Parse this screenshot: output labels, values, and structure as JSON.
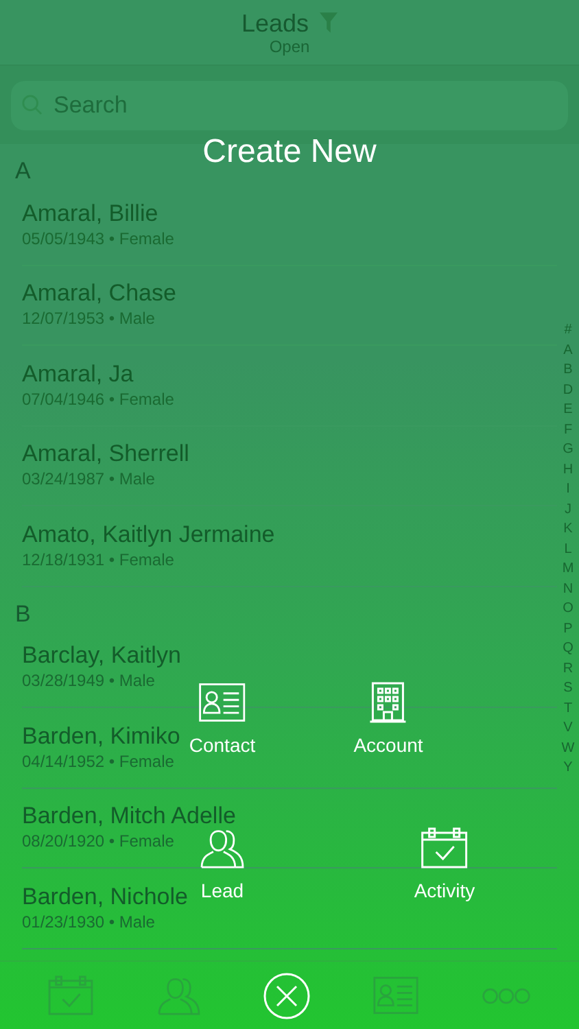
{
  "header": {
    "title": "Leads",
    "subtitle": "Open"
  },
  "search": {
    "placeholder": "Search"
  },
  "sections": [
    {
      "letter": "A",
      "rows": [
        {
          "name": "Amaral, Billie",
          "detail": "05/05/1943 • Female"
        },
        {
          "name": "Amaral, Chase",
          "detail": "12/07/1953 • Male"
        },
        {
          "name": "Amaral, Ja",
          "detail": "07/04/1946 • Female"
        },
        {
          "name": "Amaral, Sherrell",
          "detail": "03/24/1987 • Male"
        },
        {
          "name": "Amato, Kaitlyn Jermaine",
          "detail": "12/18/1931 • Female"
        }
      ]
    },
    {
      "letter": "B",
      "rows": [
        {
          "name": "Barclay, Kaitlyn",
          "detail": "03/28/1949 • Male"
        },
        {
          "name": "Barden, Kimiko",
          "detail": "04/14/1952 • Female"
        },
        {
          "name": "Barden, Mitch Adelle",
          "detail": "08/20/1920 • Female"
        },
        {
          "name": "Barden, Nichole",
          "detail": "01/23/1930 • Male"
        }
      ]
    }
  ],
  "index": [
    "#",
    "A",
    "B",
    "D",
    "E",
    "F",
    "G",
    "H",
    "I",
    "J",
    "K",
    "L",
    "M",
    "N",
    "O",
    "P",
    "Q",
    "R",
    "S",
    "T",
    "V",
    "W",
    "Y"
  ],
  "tab_bar": [
    {
      "kind": "activity"
    },
    {
      "kind": "leads"
    },
    {
      "kind": "close"
    },
    {
      "kind": "contact"
    },
    {
      "kind": "more"
    }
  ],
  "overlay": {
    "title": "Create New",
    "options": [
      {
        "kind": "contact",
        "label": "Contact"
      },
      {
        "kind": "account",
        "label": "Account"
      },
      {
        "kind": "lead",
        "label": "Lead"
      },
      {
        "kind": "activity",
        "label": "Activity"
      }
    ]
  }
}
